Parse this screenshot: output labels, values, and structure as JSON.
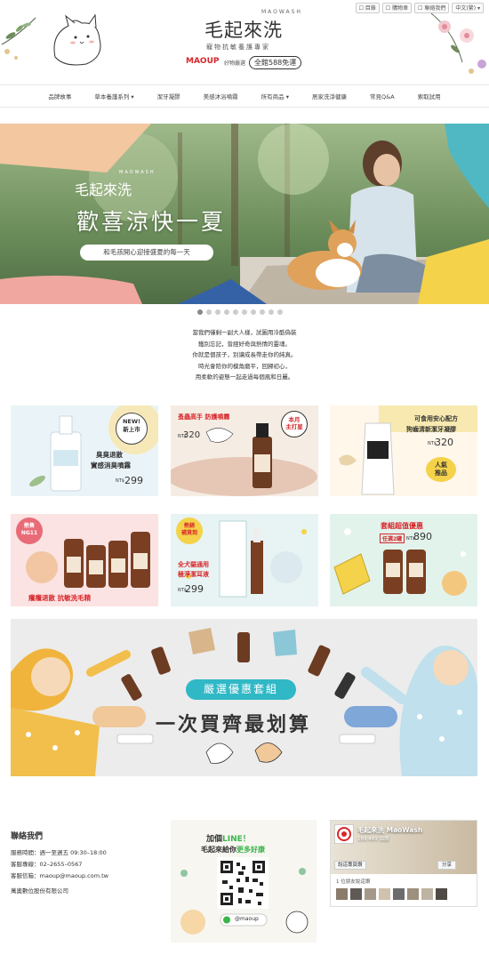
{
  "toplinks": [
    {
      "label": "☐ 目錄",
      "icon": "catalog-icon"
    },
    {
      "label": "☐ 購物車",
      "icon": "cart-icon"
    },
    {
      "label": "☐ 聯絡我們",
      "icon": "contact-icon"
    },
    {
      "label": "中文(繁) ▾",
      "icon": "language-icon"
    }
  ],
  "header": {
    "logo_cn": "毛起來洗",
    "logo_en": "MAOWASH",
    "tagline": "寵物抗敏養護專家",
    "maoup": "MAOUP",
    "maoup_sub": "好物嚴選",
    "ship": "全館588免運"
  },
  "nav": [
    "品牌故事",
    "草本養護系列 ▾",
    "潔牙凝膠",
    "美感沐浴噴霧",
    "所有商品 ▾",
    "居家洗淨健康",
    "常見Q&A",
    "索取試用"
  ],
  "hero": {
    "brand_cn": "毛起來洗",
    "brand_en": "MAOWASH",
    "title": "歡喜涼快一夏",
    "subtitle": "和毛孩開心迎接盛夏的每一天"
  },
  "carousel": {
    "count": 10,
    "active": 0
  },
  "intro": [
    "當我們僅剩一副大人樣，試圖用冷酷偽裝",
    "鐵別忘記，曾經好奇與熱情的靈魂。",
    "你就是個孩子，別讓成長帶走你的純真。",
    "時光會陪你的模角磨平，回歸初心，",
    "用柔軟的姿態一起走過每個風和日麗。"
  ],
  "products": {
    "p1": {
      "badge": "NEW!\n新上市",
      "title1": "臭臭退散",
      "title2": "實感消臭噴霧",
      "nt": "NT$",
      "price": "299"
    },
    "p2": {
      "title": "蚤蟲高手 防護噴霧",
      "nt": "NT$",
      "price": "320",
      "badge": "本月\n主打星"
    },
    "p3": {
      "title1": "可食用安心配方",
      "title2": "狗齒清新潔牙凝膠",
      "nt": "NT$",
      "price": "320",
      "badge": "人氣\n推品"
    },
    "p4": {
      "badge": "熱售\nNG11",
      "title": "癢癢退散 抗敏洗毛精"
    },
    "p5": {
      "badge": "熱銷\n補貨到",
      "title1": "全犬貓通用",
      "title2": "極淨潔耳液",
      "nt": "NT$",
      "price": "299"
    },
    "p6": {
      "title": "套組超值優惠",
      "sub": "任選2罐",
      "nt": "NT$",
      "price": "890"
    }
  },
  "banner": {
    "pill": "嚴選優惠套組",
    "title": "一次買齊最划算"
  },
  "footer": {
    "contact_title": "聯絡我們",
    "hours": "服務時間：週一至週五 09:30–18:00",
    "phone": "客服專線：02–2655–0567",
    "email": "客服信箱：maoup@maoup.com.tw",
    "company": "萬奧數位股份有限公司",
    "line_title1": "加個",
    "line_title2": "LINE！",
    "line_sub1": "毛起來給你",
    "line_sub2": "更多好康",
    "line_id": "@maoup",
    "fb_name": "毛起來洗 MaoWash",
    "fb_likes": "189,489 個讚",
    "fb_like": "說這專頁讚",
    "fb_share": "分享",
    "fb_friends": "1 位朋友說這讚"
  },
  "colors": {
    "accent_red": "#d8262a",
    "teal": "#31b8c6",
    "orange": "#e9572b",
    "nav_border": "#e6e6e6"
  }
}
